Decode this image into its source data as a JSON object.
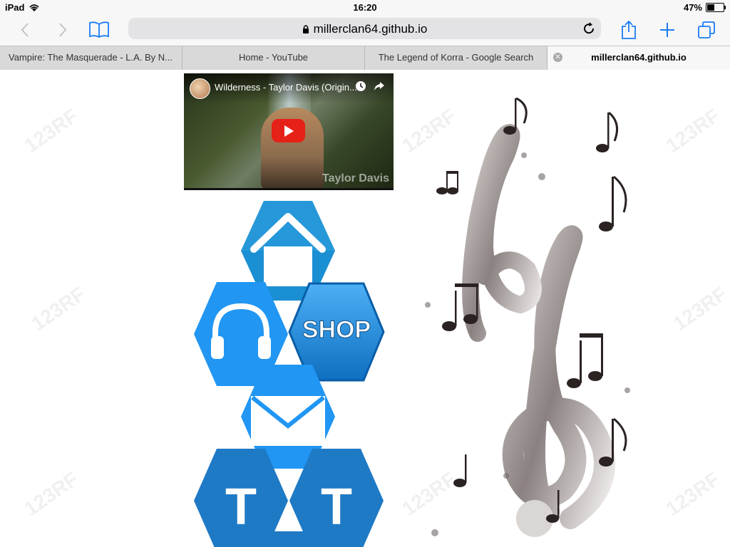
{
  "status": {
    "device": "iPad",
    "time": "16:20",
    "battery": "47%",
    "battery_level": 0.47
  },
  "browser": {
    "url": "millerclan64.github.io",
    "tabs": [
      {
        "label": "Vampire: The Masquerade - L.A. By N..."
      },
      {
        "label": "Home - YouTube"
      },
      {
        "label": "The Legend of Korra - Google Search"
      },
      {
        "label": "millerclan64.github.io",
        "active": true
      }
    ]
  },
  "video": {
    "title": "Wilderness - Taylor Davis (Origin...",
    "watermark": "Taylor Davis"
  },
  "tiles": [
    {
      "name": "home-tile",
      "icon": "home-icon",
      "color": "#1a8fd3"
    },
    {
      "name": "music-tile",
      "icon": "headphones-icon",
      "color": "#2196f3"
    },
    {
      "name": "shop-tile",
      "label": "SHOP",
      "color": "#1e88e5"
    },
    {
      "name": "mail-tile",
      "icon": "mail-icon",
      "color": "#2196f3"
    },
    {
      "name": "t-tile-left",
      "label": "T",
      "color": "#1f7ac6"
    },
    {
      "name": "t-tile-right",
      "label": "T",
      "color": "#1f7ac6"
    }
  ],
  "watermark_text": "123RF"
}
